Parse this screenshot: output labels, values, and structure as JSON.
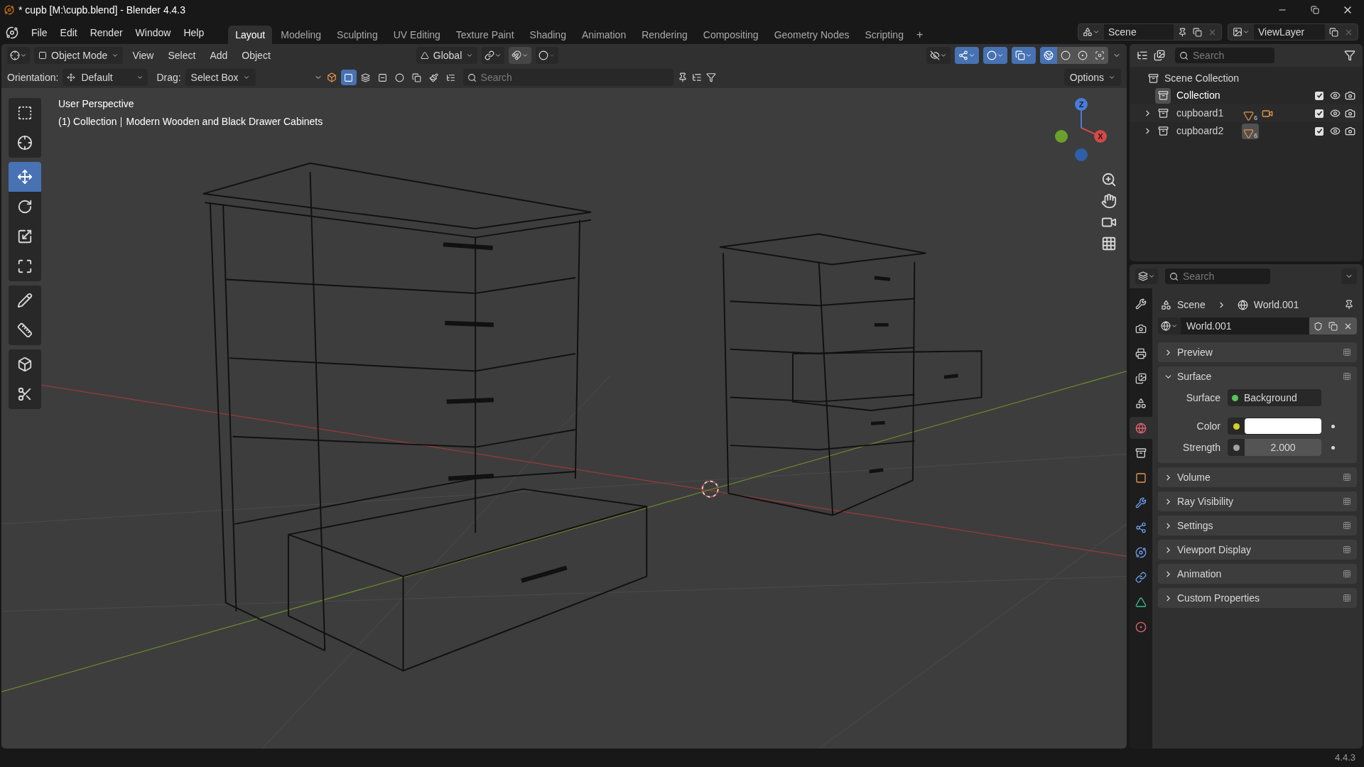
{
  "window": {
    "title": "* cupb [M:\\cupb.blend] - Blender 4.4.3"
  },
  "menu": [
    "File",
    "Edit",
    "Render",
    "Window",
    "Help"
  ],
  "workspaces": [
    {
      "label": "Layout",
      "selected": true
    },
    {
      "label": "Modeling",
      "selected": false
    },
    {
      "label": "Sculpting",
      "selected": false
    },
    {
      "label": "UV Editing",
      "selected": false
    },
    {
      "label": "Texture Paint",
      "selected": false
    },
    {
      "label": "Shading",
      "selected": false
    },
    {
      "label": "Animation",
      "selected": false
    },
    {
      "label": "Rendering",
      "selected": false
    },
    {
      "label": "Compositing",
      "selected": false
    },
    {
      "label": "Geometry Nodes",
      "selected": false
    },
    {
      "label": "Scripting",
      "selected": false
    }
  ],
  "add_workspace": "+",
  "scene": {
    "value": "Scene"
  },
  "view_layer": {
    "value": "ViewLayer"
  },
  "viewport": {
    "mode": "Object Mode",
    "menus": [
      "View",
      "Select",
      "Add",
      "Object"
    ],
    "transform_orientation": "Global",
    "toggles": [
      {
        "kind": "visibility",
        "on": false
      },
      {
        "kind": "gizmos",
        "on": true
      },
      {
        "kind": "overlays",
        "on": true
      },
      {
        "kind": "xray",
        "on": true
      }
    ],
    "shading": [
      {
        "kind": "wireframe",
        "selected": true
      },
      {
        "kind": "solid",
        "selected": false
      },
      {
        "kind": "material",
        "selected": false
      },
      {
        "kind": "rendered",
        "selected": false
      }
    ],
    "orientation_label": "Orientation:",
    "orientation": "Default",
    "drag_label": "Drag:",
    "drag": "Select Box",
    "select_modes": [
      {
        "kind": "set",
        "selected": true
      },
      {
        "kind": "extend",
        "selected": false
      },
      {
        "kind": "subtract",
        "selected": false
      },
      {
        "kind": "invert",
        "selected": false
      },
      {
        "kind": "intersect",
        "selected": false
      },
      {
        "kind": "paint",
        "selected": false
      },
      {
        "kind": "stack",
        "selected": false
      }
    ],
    "search_placeholder": "Search",
    "options": "Options",
    "tool_groups": [
      [
        {
          "kind": "select_box",
          "selected": false
        },
        {
          "kind": "cursor",
          "selected": false
        }
      ],
      [
        {
          "kind": "move",
          "selected": true
        },
        {
          "kind": "rotate",
          "selected": false
        },
        {
          "kind": "scale",
          "selected": false
        },
        {
          "kind": "transform",
          "selected": false
        }
      ],
      [
        {
          "kind": "annotate",
          "selected": false
        },
        {
          "kind": "measure",
          "selected": false
        }
      ],
      [
        {
          "kind": "add_cube",
          "selected": false
        },
        {
          "kind": "cut",
          "selected": false
        }
      ]
    ],
    "view_name": "User Perspective",
    "collection": "(1) Collection",
    "object": "Modern Wooden and Black Drawer Cabinets",
    "gizmo_axes": [
      "Z",
      "X"
    ]
  },
  "outliner": {
    "search_placeholder": "Search",
    "root": "Scene Collection",
    "items": [
      {
        "name": "Collection",
        "expandable": false,
        "selected": true,
        "checked": true,
        "visible": true,
        "renderable": true
      },
      {
        "name": "cupboard1",
        "expandable": true,
        "selected": false,
        "checked": true,
        "visible": true,
        "renderable": true,
        "data": [
          {
            "kind": "mesh",
            "count": "6",
            "selected": false
          },
          {
            "kind": "camera",
            "selected": false
          }
        ]
      },
      {
        "name": "cupboard2",
        "expandable": true,
        "selected": false,
        "checked": true,
        "visible": true,
        "renderable": true,
        "data": [
          {
            "kind": "mesh",
            "count": "6",
            "selected": true
          }
        ]
      }
    ]
  },
  "properties": {
    "search_placeholder": "Search",
    "tabs": [
      {
        "kind": "tool",
        "selected": false
      },
      {
        "kind": "render",
        "selected": false
      },
      {
        "kind": "output",
        "selected": false
      },
      {
        "kind": "view_layer",
        "selected": false
      },
      {
        "kind": "scene",
        "selected": false
      },
      {
        "kind": "world",
        "selected": true
      },
      {
        "kind": "collection",
        "selected": false
      },
      {
        "kind": "object",
        "selected": false
      },
      {
        "kind": "modifiers",
        "selected": false
      },
      {
        "kind": "particles",
        "selected": false
      },
      {
        "kind": "physics",
        "selected": false
      },
      {
        "kind": "constraints",
        "selected": false
      },
      {
        "kind": "data",
        "selected": false
      },
      {
        "kind": "material",
        "selected": false
      }
    ],
    "breadcrumb": [
      "Scene",
      "World.001"
    ],
    "datablock": "World.001",
    "panels": [
      {
        "title": "Preview",
        "expanded": false
      },
      {
        "title": "Surface",
        "expanded": true,
        "fields": [
          {
            "label": "Surface",
            "kind": "node",
            "value": "Background"
          },
          {
            "label": "Color",
            "kind": "color",
            "color": "#ffffff"
          },
          {
            "label": "Strength",
            "kind": "number",
            "value": "2.000"
          }
        ]
      },
      {
        "title": "Volume",
        "expanded": false
      },
      {
        "title": "Ray Visibility",
        "expanded": false
      },
      {
        "title": "Settings",
        "expanded": false
      },
      {
        "title": "Viewport Display",
        "expanded": false
      },
      {
        "title": "Animation",
        "expanded": false
      },
      {
        "title": "Custom Properties",
        "expanded": false
      }
    ]
  },
  "status_bar": {
    "version": "4.4.3"
  }
}
